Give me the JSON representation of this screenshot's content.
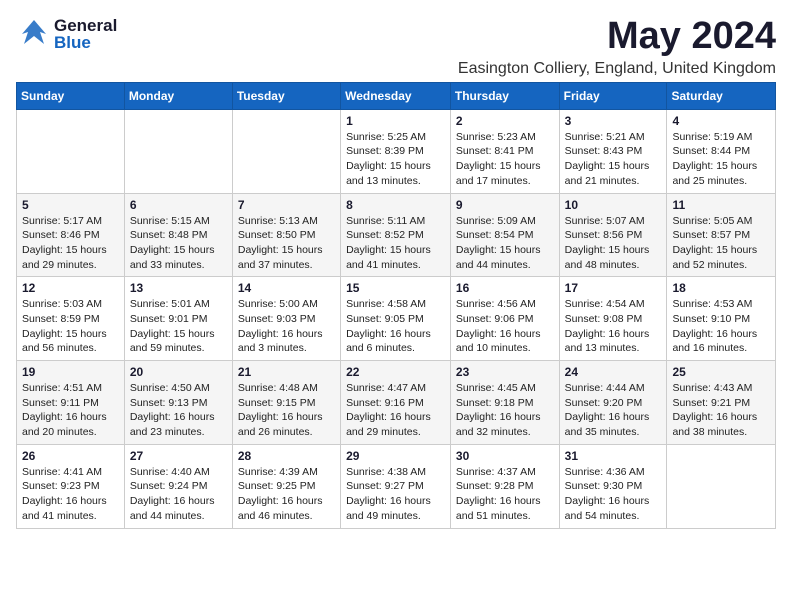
{
  "header": {
    "logo_general": "General",
    "logo_blue": "Blue",
    "month_title": "May 2024",
    "location": "Easington Colliery, England, United Kingdom"
  },
  "days_of_week": [
    "Sunday",
    "Monday",
    "Tuesday",
    "Wednesday",
    "Thursday",
    "Friday",
    "Saturday"
  ],
  "weeks": [
    [
      {
        "day": "",
        "info": ""
      },
      {
        "day": "",
        "info": ""
      },
      {
        "day": "",
        "info": ""
      },
      {
        "day": "1",
        "info": "Sunrise: 5:25 AM\nSunset: 8:39 PM\nDaylight: 15 hours\nand 13 minutes."
      },
      {
        "day": "2",
        "info": "Sunrise: 5:23 AM\nSunset: 8:41 PM\nDaylight: 15 hours\nand 17 minutes."
      },
      {
        "day": "3",
        "info": "Sunrise: 5:21 AM\nSunset: 8:43 PM\nDaylight: 15 hours\nand 21 minutes."
      },
      {
        "day": "4",
        "info": "Sunrise: 5:19 AM\nSunset: 8:44 PM\nDaylight: 15 hours\nand 25 minutes."
      }
    ],
    [
      {
        "day": "5",
        "info": "Sunrise: 5:17 AM\nSunset: 8:46 PM\nDaylight: 15 hours\nand 29 minutes."
      },
      {
        "day": "6",
        "info": "Sunrise: 5:15 AM\nSunset: 8:48 PM\nDaylight: 15 hours\nand 33 minutes."
      },
      {
        "day": "7",
        "info": "Sunrise: 5:13 AM\nSunset: 8:50 PM\nDaylight: 15 hours\nand 37 minutes."
      },
      {
        "day": "8",
        "info": "Sunrise: 5:11 AM\nSunset: 8:52 PM\nDaylight: 15 hours\nand 41 minutes."
      },
      {
        "day": "9",
        "info": "Sunrise: 5:09 AM\nSunset: 8:54 PM\nDaylight: 15 hours\nand 44 minutes."
      },
      {
        "day": "10",
        "info": "Sunrise: 5:07 AM\nSunset: 8:56 PM\nDaylight: 15 hours\nand 48 minutes."
      },
      {
        "day": "11",
        "info": "Sunrise: 5:05 AM\nSunset: 8:57 PM\nDaylight: 15 hours\nand 52 minutes."
      }
    ],
    [
      {
        "day": "12",
        "info": "Sunrise: 5:03 AM\nSunset: 8:59 PM\nDaylight: 15 hours\nand 56 minutes."
      },
      {
        "day": "13",
        "info": "Sunrise: 5:01 AM\nSunset: 9:01 PM\nDaylight: 15 hours\nand 59 minutes."
      },
      {
        "day": "14",
        "info": "Sunrise: 5:00 AM\nSunset: 9:03 PM\nDaylight: 16 hours\nand 3 minutes."
      },
      {
        "day": "15",
        "info": "Sunrise: 4:58 AM\nSunset: 9:05 PM\nDaylight: 16 hours\nand 6 minutes."
      },
      {
        "day": "16",
        "info": "Sunrise: 4:56 AM\nSunset: 9:06 PM\nDaylight: 16 hours\nand 10 minutes."
      },
      {
        "day": "17",
        "info": "Sunrise: 4:54 AM\nSunset: 9:08 PM\nDaylight: 16 hours\nand 13 minutes."
      },
      {
        "day": "18",
        "info": "Sunrise: 4:53 AM\nSunset: 9:10 PM\nDaylight: 16 hours\nand 16 minutes."
      }
    ],
    [
      {
        "day": "19",
        "info": "Sunrise: 4:51 AM\nSunset: 9:11 PM\nDaylight: 16 hours\nand 20 minutes."
      },
      {
        "day": "20",
        "info": "Sunrise: 4:50 AM\nSunset: 9:13 PM\nDaylight: 16 hours\nand 23 minutes."
      },
      {
        "day": "21",
        "info": "Sunrise: 4:48 AM\nSunset: 9:15 PM\nDaylight: 16 hours\nand 26 minutes."
      },
      {
        "day": "22",
        "info": "Sunrise: 4:47 AM\nSunset: 9:16 PM\nDaylight: 16 hours\nand 29 minutes."
      },
      {
        "day": "23",
        "info": "Sunrise: 4:45 AM\nSunset: 9:18 PM\nDaylight: 16 hours\nand 32 minutes."
      },
      {
        "day": "24",
        "info": "Sunrise: 4:44 AM\nSunset: 9:20 PM\nDaylight: 16 hours\nand 35 minutes."
      },
      {
        "day": "25",
        "info": "Sunrise: 4:43 AM\nSunset: 9:21 PM\nDaylight: 16 hours\nand 38 minutes."
      }
    ],
    [
      {
        "day": "26",
        "info": "Sunrise: 4:41 AM\nSunset: 9:23 PM\nDaylight: 16 hours\nand 41 minutes."
      },
      {
        "day": "27",
        "info": "Sunrise: 4:40 AM\nSunset: 9:24 PM\nDaylight: 16 hours\nand 44 minutes."
      },
      {
        "day": "28",
        "info": "Sunrise: 4:39 AM\nSunset: 9:25 PM\nDaylight: 16 hours\nand 46 minutes."
      },
      {
        "day": "29",
        "info": "Sunrise: 4:38 AM\nSunset: 9:27 PM\nDaylight: 16 hours\nand 49 minutes."
      },
      {
        "day": "30",
        "info": "Sunrise: 4:37 AM\nSunset: 9:28 PM\nDaylight: 16 hours\nand 51 minutes."
      },
      {
        "day": "31",
        "info": "Sunrise: 4:36 AM\nSunset: 9:30 PM\nDaylight: 16 hours\nand 54 minutes."
      },
      {
        "day": "",
        "info": ""
      }
    ]
  ]
}
